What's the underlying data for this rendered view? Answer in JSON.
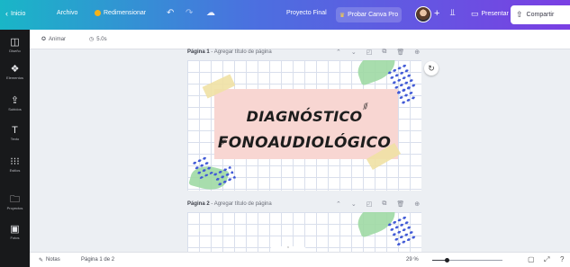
{
  "topbar": {
    "home": "Inicio",
    "file": "Archivo",
    "resize": "Redimensionar",
    "project_name": "Proyecto Final",
    "try_pro": "Probar Canva Pro",
    "present": "Presentar",
    "share": "Compartir"
  },
  "sidebar": {
    "items": [
      {
        "label": "Diseño",
        "icon": "layout-icon"
      },
      {
        "label": "Elementos",
        "icon": "shapes-icon"
      },
      {
        "label": "Subidos",
        "icon": "upload-icon"
      },
      {
        "label": "Texto",
        "icon": "text-icon"
      },
      {
        "label": "Estilos",
        "icon": "styles-icon"
      },
      {
        "label": "Proyectos",
        "icon": "folder-icon"
      },
      {
        "label": "Fotos",
        "icon": "photos-icon"
      }
    ]
  },
  "subtoolbar": {
    "animate": "Animar",
    "duration": "5.0s"
  },
  "pages": [
    {
      "label": "Página 1",
      "placeholder": " - Agregar título de página"
    },
    {
      "label": "Página 2",
      "placeholder": " - Agregar título de página"
    }
  ],
  "design": {
    "title_line1": "DIAGNÓSTICO",
    "title_line2": "FONOAUDIOLÓGICO",
    "accent_pink": "#f8d6d2",
    "accent_blue": "#3f58d6",
    "accent_green": "#9fd9a4"
  },
  "bottombar": {
    "notes": "Notas",
    "page_count": "Página 1 de 2",
    "zoom": "29 %",
    "zoom_value": 29
  }
}
